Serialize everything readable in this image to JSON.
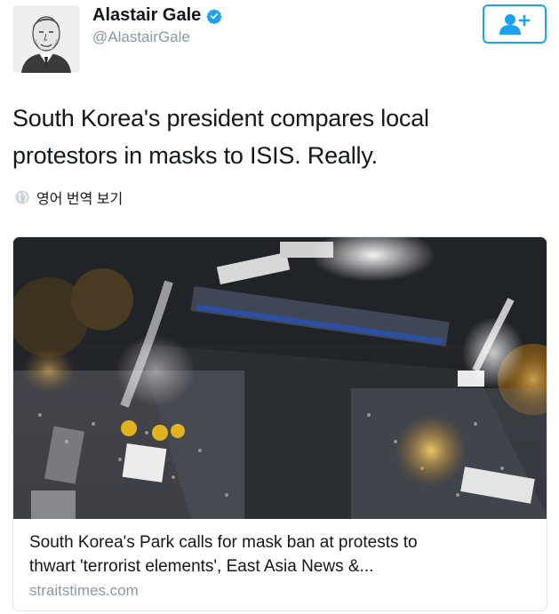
{
  "author": {
    "display_name": "Alastair Gale",
    "handle": "@AlastairGale",
    "verified": true,
    "avatar_icon": "portrait-sketch-avatar"
  },
  "follow_button": {
    "icon": "add-user-icon",
    "accent": "#1da1f2"
  },
  "tweet": {
    "text_line1": "South Korea's president compares local",
    "text_line2": "protestors in masks to ISIS. Really."
  },
  "translate": {
    "icon": "globe-icon",
    "label": "영어 번역 보기"
  },
  "link_card": {
    "image": "night-protest-water-cannon-photo",
    "title_line1": "South Korea's Park calls for mask ban at protests to",
    "title_line2": "thwart 'terrorist elements', East Asia News &...",
    "domain": "straitstimes.com"
  },
  "colors": {
    "accent": "#1da1f2",
    "secondary_text": "#8899a6",
    "primary_text": "#14171a",
    "border": "#e1e8ed"
  }
}
